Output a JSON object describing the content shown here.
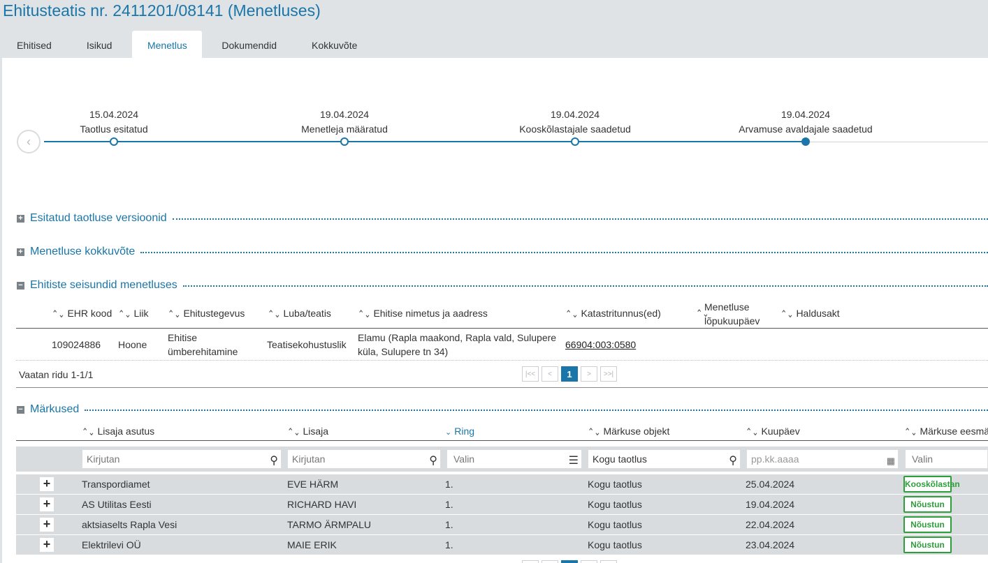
{
  "title": "Ehitusteatis nr. 2411201/08141 (Menetluses)",
  "tabs": [
    {
      "label": "Ehitised"
    },
    {
      "label": "Isikud"
    },
    {
      "label": "Menetlus"
    },
    {
      "label": "Dokumendid"
    },
    {
      "label": "Kokkuvõte"
    }
  ],
  "active_tab": "Menetlus",
  "timeline": {
    "back_glyph": "‹",
    "steps": [
      {
        "date": "15.04.2024",
        "label": "Taotlus esitatud"
      },
      {
        "date": "19.04.2024",
        "label": "Menetleja määratud"
      },
      {
        "date": "19.04.2024",
        "label": "Kooskõlastajale saadetud"
      },
      {
        "date": "19.04.2024",
        "label": "Arvamuse avaldajale saadetud"
      }
    ]
  },
  "sections": {
    "versions": {
      "title": "Esitatud taotluse versioonid",
      "toggle": "+"
    },
    "summary": {
      "title": "Menetluse kokkuvõte",
      "toggle": "+"
    },
    "states": {
      "title": "Ehitiste seisundid menetluses",
      "toggle": "−"
    },
    "remarks": {
      "title": "Märkused",
      "toggle": "−"
    }
  },
  "states_table": {
    "headers": {
      "ehr": "EHR kood",
      "liik": "Liik",
      "tegevus": "Ehitustegevus",
      "luba": "Luba/teatis",
      "nimetus": "Ehitise nimetus ja aadress",
      "kataster": "Katastritunnus(ed)",
      "lopp1": "Menetluse",
      "lopp2": "lõpukuupäev",
      "haldusakt": "Haldusakt"
    },
    "row": {
      "ehr": "109024886",
      "liik": "Hoone",
      "tegevus1": "Ehitise",
      "tegevus2": "ümberehitamine",
      "luba": "Teatisekohustuslik",
      "nimetus1": "Elamu (Rapla maakond, Rapla vald, Sulupere",
      "nimetus2": "küla, Sulupere tn 34)",
      "kataster": "66904:003:0580"
    },
    "rows_info": "Vaatan ridu 1-1/1",
    "page": "1"
  },
  "remarks_table": {
    "headers": {
      "asutus": "Lisaja asutus",
      "lisaja": "Lisaja",
      "ring": "Ring",
      "objekt": "Märkuse objekt",
      "kuupaev": "Kuupäev",
      "eesmark": "Märkuse eesmär"
    },
    "filters": {
      "asutus": "Kirjutan",
      "lisaja": "Kirjutan",
      "ring": "Valin",
      "objekt": "Kogu taotlus",
      "kuupaev": "pp.kk.aaaa",
      "eesmark": "Valin"
    },
    "rows": [
      {
        "asutus": "Transpordiamet",
        "lisaja": "EVE HÄRM",
        "ring": "1.",
        "objekt": "Kogu taotlus",
        "kuupaev": "25.04.2024",
        "eesmark": "Kooskõlastan"
      },
      {
        "asutus": "AS Utilitas Eesti",
        "lisaja": "RICHARD HAVI",
        "ring": "1.",
        "objekt": "Kogu taotlus",
        "kuupaev": "19.04.2024",
        "eesmark": "Nõustun"
      },
      {
        "asutus": "aktsiaselts Rapla Vesi",
        "lisaja": "TARMO ÄRMPALU",
        "ring": "1.",
        "objekt": "Kogu taotlus",
        "kuupaev": "22.04.2024",
        "eesmark": "Nõustun"
      },
      {
        "asutus": "Elektrilevi OÜ",
        "lisaja": "MAIE ERIK",
        "ring": "1.",
        "objekt": "Kogu taotlus",
        "kuupaev": "23.04.2024",
        "eesmark": "Nõustun"
      }
    ]
  },
  "colors": {
    "accent": "#1a76a8",
    "badge_green": "#2e9e3a",
    "background": "#dfe3e6"
  }
}
